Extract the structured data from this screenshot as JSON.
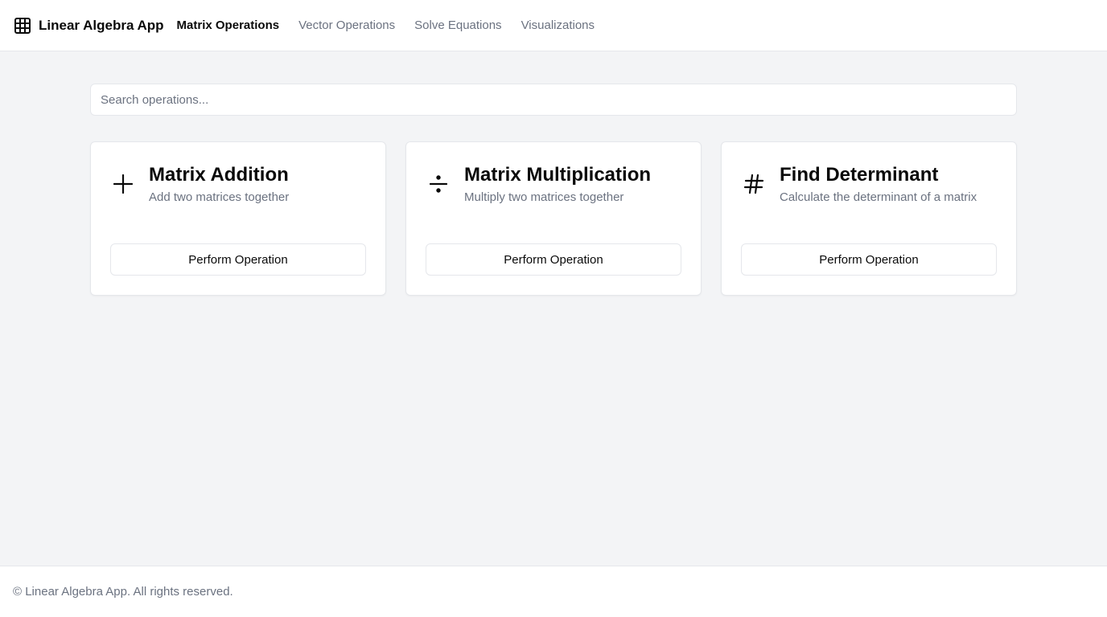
{
  "header": {
    "app_title": "Linear Algebra App",
    "brand_icon": "grid-icon",
    "nav": [
      {
        "label": "Matrix Operations",
        "active": true
      },
      {
        "label": "Vector Operations",
        "active": false
      },
      {
        "label": "Solve Equations",
        "active": false
      },
      {
        "label": "Visualizations",
        "active": false
      }
    ]
  },
  "search": {
    "placeholder": "Search operations...",
    "value": ""
  },
  "cards": [
    {
      "icon": "plus-icon",
      "title": "Matrix Addition",
      "description": "Add two matrices together",
      "button_label": "Perform Operation"
    },
    {
      "icon": "divide-icon",
      "title": "Matrix Multiplication",
      "description": "Multiply two matrices together",
      "button_label": "Perform Operation"
    },
    {
      "icon": "hash-icon",
      "title": "Find Determinant",
      "description": "Calculate the determinant of a matrix",
      "button_label": "Perform Operation"
    }
  ],
  "footer": {
    "text": "© Linear Algebra App. All rights reserved."
  },
  "colors": {
    "background": "#f3f4f6",
    "surface": "#ffffff",
    "border": "#e5e7eb",
    "text_primary": "#0a0a0a",
    "text_muted": "#6b7280"
  }
}
